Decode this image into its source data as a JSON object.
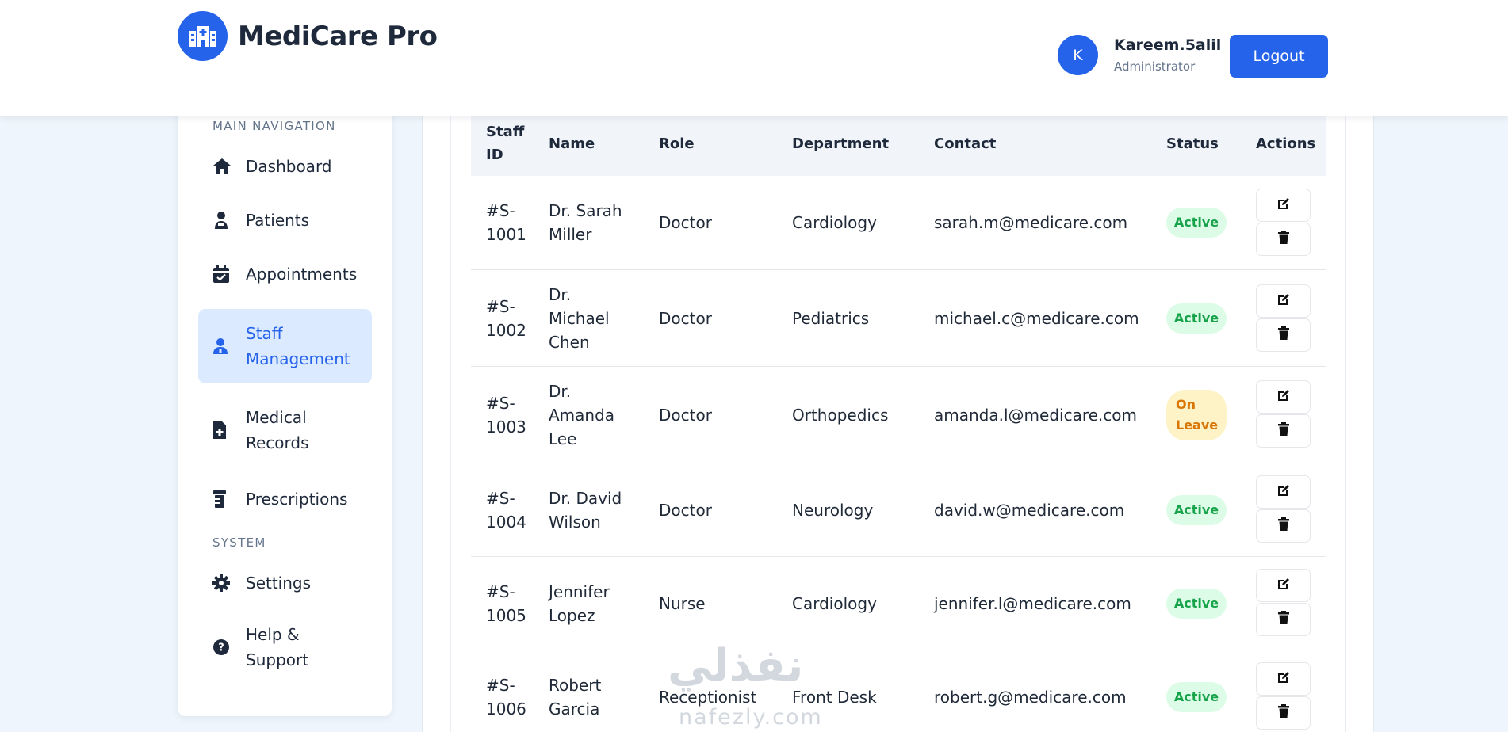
{
  "app": {
    "title": "MediCare Pro",
    "accent": "#2563eb"
  },
  "header": {
    "user": {
      "initial": "K",
      "name": "Kareem.5alil",
      "role": "Administrator"
    },
    "logout_label": "Logout"
  },
  "sidebar": {
    "main_section_label": "MAIN NAVIGATION",
    "system_section_label": "SYSTEM",
    "main_items": [
      {
        "label": "Dashboard",
        "icon": "home-icon"
      },
      {
        "label": "Patients",
        "icon": "user-injured-icon"
      },
      {
        "label": "Appointments",
        "icon": "calendar-check-icon"
      },
      {
        "label": "Staff Management",
        "icon": "user-md-icon",
        "active": true
      },
      {
        "label": "Medical Records",
        "icon": "file-medical-icon"
      },
      {
        "label": "Prescriptions",
        "icon": "prescription-bottle-icon"
      }
    ],
    "system_items": [
      {
        "label": "Settings",
        "icon": "gear-icon"
      },
      {
        "label": "Help & Support",
        "icon": "question-circle-icon"
      }
    ]
  },
  "table": {
    "headers": {
      "id": "Staff ID",
      "name": "Name",
      "role": "Role",
      "department": "Department",
      "contact": "Contact",
      "status": "Status",
      "actions": "Actions"
    },
    "rows": [
      {
        "id": "#S-1001",
        "name": "Dr. Sarah Miller",
        "role": "Doctor",
        "department": "Cardiology",
        "contact": "sarah.m@medicare.com",
        "status": "Active"
      },
      {
        "id": "#S-1002",
        "name": "Dr. Michael Chen",
        "role": "Doctor",
        "department": "Pediatrics",
        "contact": "michael.c@medicare.com",
        "status": "Active"
      },
      {
        "id": "#S-1003",
        "name": "Dr. Amanda Lee",
        "role": "Doctor",
        "department": "Orthopedics",
        "contact": "amanda.l@medicare.com",
        "status": "On Leave"
      },
      {
        "id": "#S-1004",
        "name": "Dr. David Wilson",
        "role": "Doctor",
        "department": "Neurology",
        "contact": "david.w@medicare.com",
        "status": "Active"
      },
      {
        "id": "#S-1005",
        "name": "Jennifer Lopez",
        "role": "Nurse",
        "department": "Cardiology",
        "contact": "jennifer.l@medicare.com",
        "status": "Active"
      },
      {
        "id": "#S-1006",
        "name": "Robert Garcia",
        "role": "Receptionist",
        "department": "Front Desk",
        "contact": "robert.g@medicare.com",
        "status": "Active"
      }
    ],
    "status_colors": {
      "Active": "#16a34a",
      "On Leave": "#d97706"
    }
  },
  "watermark": {
    "arabic": "نفذلي",
    "latin": "nafezly.com"
  }
}
